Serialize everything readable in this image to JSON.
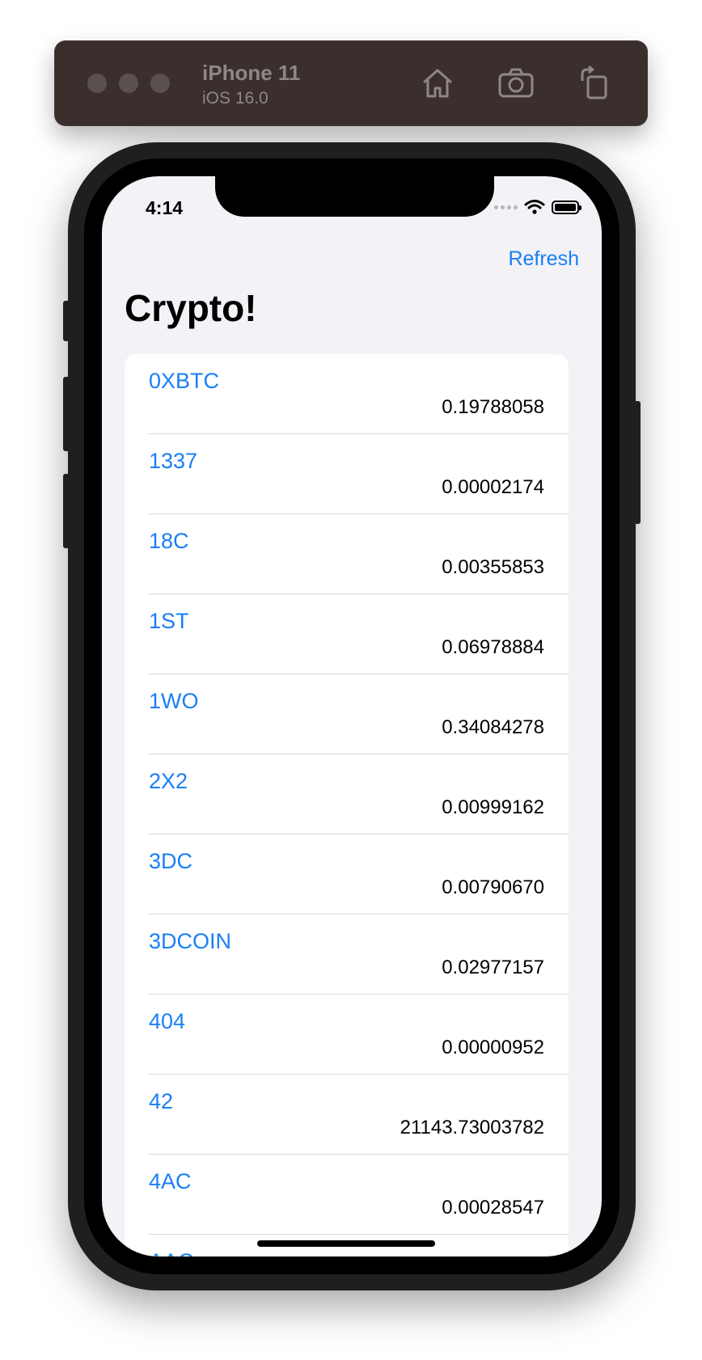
{
  "simulator": {
    "device_name": "iPhone 11",
    "os_version": "iOS 16.0",
    "toolbar_icons": [
      "home-icon",
      "camera-icon",
      "rotate-icon"
    ]
  },
  "status_bar": {
    "time": "4:14"
  },
  "nav": {
    "refresh_label": "Refresh",
    "title": "Crypto!"
  },
  "colors": {
    "accent": "#1a7ff5",
    "background": "#f2f2f7",
    "toolbar": "#3a2f2c"
  },
  "coins": [
    {
      "symbol": "0XBTC",
      "price": "0.19788058"
    },
    {
      "symbol": "1337",
      "price": "0.00002174"
    },
    {
      "symbol": "18C",
      "price": "0.00355853"
    },
    {
      "symbol": "1ST",
      "price": "0.06978884"
    },
    {
      "symbol": "1WO",
      "price": "0.34084278"
    },
    {
      "symbol": "2X2",
      "price": "0.00999162"
    },
    {
      "symbol": "3DC",
      "price": "0.00790670"
    },
    {
      "symbol": "3DCOIN",
      "price": "0.02977157"
    },
    {
      "symbol": "404",
      "price": "0.00000952"
    },
    {
      "symbol": "42",
      "price": "21143.73003782"
    },
    {
      "symbol": "4AC",
      "price": "0.00028547"
    },
    {
      "symbol": "AAC",
      "price": ""
    }
  ]
}
